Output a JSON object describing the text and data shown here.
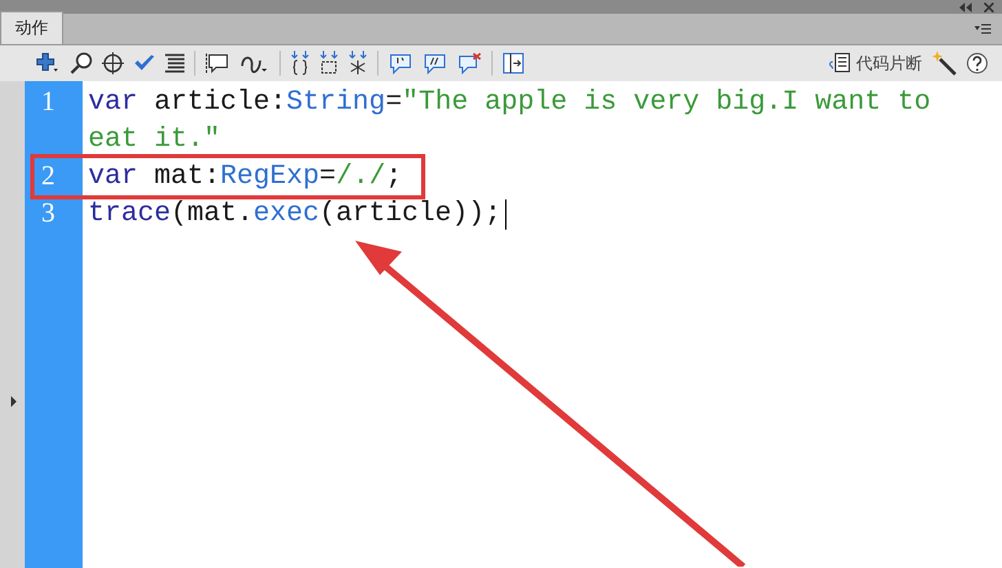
{
  "tabs": [
    {
      "label": "动作",
      "selected": true
    }
  ],
  "toolbar": {
    "snippets_label": "代码片断"
  },
  "code": [
    {
      "number": "1",
      "caret": false,
      "highlighted": false,
      "rows": [
        [
          {
            "text": "var",
            "kind": "keyword"
          },
          {
            "text": " article:",
            "kind": "plain"
          },
          {
            "text": "String",
            "kind": "type"
          },
          {
            "text": "=",
            "kind": "plain"
          },
          {
            "text": "\"The apple is very big.I want to",
            "kind": "string"
          }
        ],
        [
          {
            "text": "eat it.\"",
            "kind": "string"
          }
        ]
      ]
    },
    {
      "number": "2",
      "caret": false,
      "highlighted": true,
      "rows": [
        [
          {
            "text": "var",
            "kind": "keyword"
          },
          {
            "text": " mat:",
            "kind": "plain"
          },
          {
            "text": "RegExp",
            "kind": "type"
          },
          {
            "text": "=",
            "kind": "plain"
          },
          {
            "text": "/./",
            "kind": "string"
          },
          {
            "text": ";",
            "kind": "plain"
          }
        ]
      ]
    },
    {
      "number": "3",
      "caret": true,
      "highlighted": false,
      "rows": [
        [
          {
            "text": "trace",
            "kind": "keyword"
          },
          {
            "text": "(mat.",
            "kind": "plain"
          },
          {
            "text": "exec",
            "kind": "type"
          },
          {
            "text": "(article));",
            "kind": "plain"
          }
        ]
      ]
    }
  ]
}
